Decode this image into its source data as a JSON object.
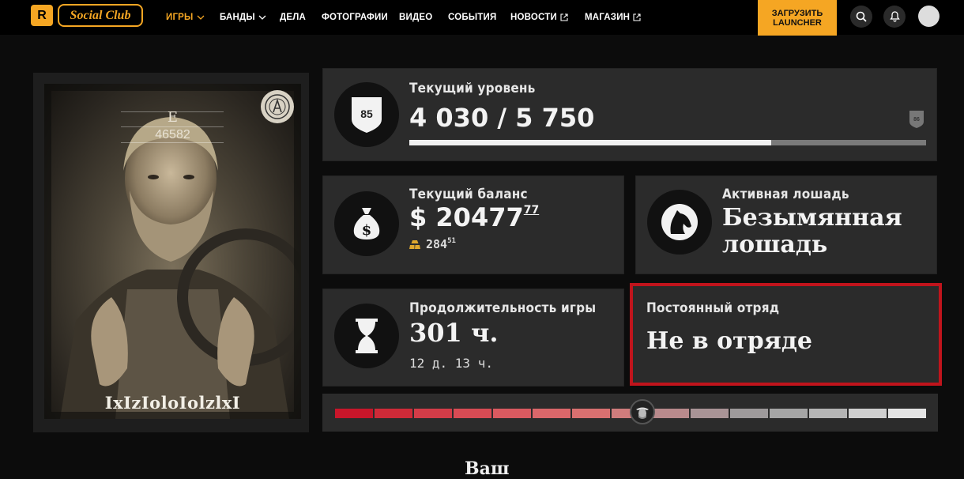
{
  "nav": {
    "logo_r": "R",
    "logo_text": "Social Club",
    "items": [
      {
        "label": "ИГРЫ",
        "active": true,
        "dropdown": true
      },
      {
        "label": "БАНДЫ",
        "active": false,
        "dropdown": true
      },
      {
        "label": "ДЕЛА"
      },
      {
        "label": "ФОТОГРАФИИ"
      },
      {
        "label": "ВИДЕО"
      },
      {
        "label": "СОБЫТИЯ"
      },
      {
        "label": "НОВОСТИ",
        "external": true
      },
      {
        "label": "МАГАЗИН",
        "external": true
      }
    ],
    "launcher_line1": "ЗАГРУЗИТЬ",
    "launcher_line2": "LAUNCHER",
    "accent": "#f5a623"
  },
  "profile": {
    "grade": "E",
    "id": "46582",
    "name": "IxIzIoloIolzlxI"
  },
  "level": {
    "label": "Текущий уровень",
    "badge": "85",
    "value": "4 030 / 5 750",
    "progress": 0.701,
    "next_badge": "86"
  },
  "balance": {
    "label": "Текущий баланс",
    "dollars": "$ 20477",
    "cents": "77",
    "gold": "284",
    "gold_frac": "51"
  },
  "horse": {
    "label": "Активная лошадь",
    "name_line1": "Безымянная",
    "name_line2": "лошадь"
  },
  "playtime": {
    "label": "Продолжительность игры",
    "hours": "301 ч.",
    "detail": "12 д. 13 ч."
  },
  "posse": {
    "label": "Постоянный отряд",
    "value": "Не в отряде",
    "frame_color": "#c0141c"
  },
  "honor": {
    "position": 0.52
  },
  "bottom": {
    "title": "Ваш"
  }
}
